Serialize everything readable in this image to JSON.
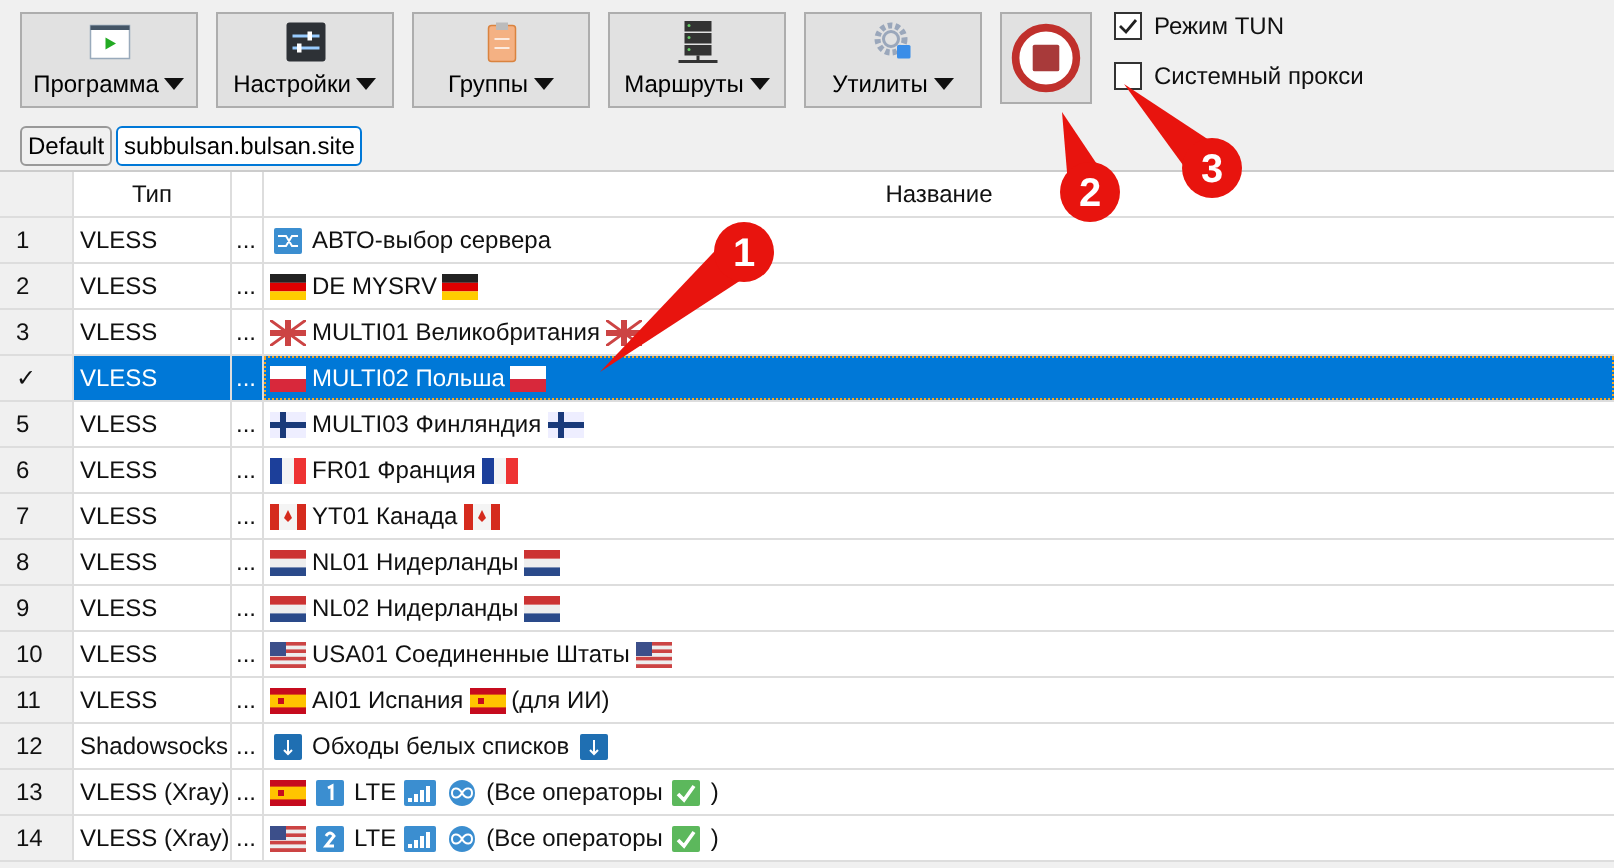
{
  "toolbar": [
    {
      "label": "Программа"
    },
    {
      "label": "Настройки"
    },
    {
      "label": "Группы"
    },
    {
      "label": "Маршруты"
    },
    {
      "label": "Утилиты"
    }
  ],
  "stop_button": {
    "kind": "stop"
  },
  "options": [
    {
      "label": "Режим TUN",
      "checked": true
    },
    {
      "label": "Системный прокси",
      "checked": false
    }
  ],
  "tabs": [
    {
      "label": "Default",
      "selected": false
    },
    {
      "label": "subbulsan.bulsan.site",
      "selected": true
    }
  ],
  "table": {
    "columns": [
      "Тип",
      "Название"
    ],
    "rows": [
      {
        "index": "1",
        "type": "VLESS",
        "dots": "...",
        "selected": false,
        "name": [
          {
            "kind": "icon"
          },
          {
            "kind": "text",
            "text": "АВТО-выбор сервера"
          }
        ]
      },
      {
        "index": "2",
        "type": "VLESS",
        "dots": "...",
        "selected": false,
        "name": [
          {
            "kind": "icon"
          },
          {
            "kind": "text",
            "text": "DE MYSRV"
          },
          {
            "kind": "icon"
          }
        ]
      },
      {
        "index": "3",
        "type": "VLESS",
        "dots": "...",
        "selected": false,
        "name": [
          {
            "kind": "icon"
          },
          {
            "kind": "text",
            "text": "MULTI01 Великобритания"
          },
          {
            "kind": "icon"
          }
        ]
      },
      {
        "index": "✓",
        "type": "VLESS",
        "dots": "...",
        "selected": true,
        "name": [
          {
            "kind": "icon"
          },
          {
            "kind": "text",
            "text": "MULTI02 Польша"
          },
          {
            "kind": "icon"
          }
        ]
      },
      {
        "index": "5",
        "type": "VLESS",
        "dots": "...",
        "selected": false,
        "name": [
          {
            "kind": "icon"
          },
          {
            "kind": "text",
            "text": "MULTI03 Финляндия"
          },
          {
            "kind": "icon"
          }
        ]
      },
      {
        "index": "6",
        "type": "VLESS",
        "dots": "...",
        "selected": false,
        "name": [
          {
            "kind": "icon"
          },
          {
            "kind": "text",
            "text": "FR01 Франция"
          },
          {
            "kind": "icon"
          }
        ]
      },
      {
        "index": "7",
        "type": "VLESS",
        "dots": "...",
        "selected": false,
        "name": [
          {
            "kind": "icon"
          },
          {
            "kind": "text",
            "text": "YT01 Канада"
          },
          {
            "kind": "icon"
          }
        ]
      },
      {
        "index": "8",
        "type": "VLESS",
        "dots": "...",
        "selected": false,
        "name": [
          {
            "kind": "icon"
          },
          {
            "kind": "text",
            "text": "NL01  Нидерланды"
          },
          {
            "kind": "icon"
          }
        ]
      },
      {
        "index": "9",
        "type": "VLESS",
        "dots": "...",
        "selected": false,
        "name": [
          {
            "kind": "icon"
          },
          {
            "kind": "text",
            "text": "NL02 Нидерланды"
          },
          {
            "kind": "icon"
          }
        ]
      },
      {
        "index": "10",
        "type": "VLESS",
        "dots": "...",
        "selected": false,
        "name": [
          {
            "kind": "icon"
          },
          {
            "kind": "text",
            "text": "USA01 Соединенные Штаты"
          },
          {
            "kind": "icon"
          }
        ]
      },
      {
        "index": "11",
        "type": "VLESS",
        "dots": "...",
        "selected": false,
        "name": [
          {
            "kind": "icon"
          },
          {
            "kind": "text",
            "text": "AI01 Испания"
          },
          {
            "kind": "icon"
          },
          {
            "kind": "text",
            "text": "(для ИИ)"
          }
        ]
      },
      {
        "index": "12",
        "type": "Shadowsocks",
        "dots": "...",
        "selected": false,
        "name": [
          {
            "kind": "icon"
          },
          {
            "kind": "text",
            "text": "Обходы белых списков"
          },
          {
            "kind": "icon"
          }
        ]
      },
      {
        "index": "13",
        "type": "VLESS (Xray)",
        "dots": "...",
        "selected": false,
        "name": [
          {
            "kind": "icon"
          },
          {
            "kind": "icon"
          },
          {
            "kind": "text",
            "text": "LTE"
          },
          {
            "kind": "icon"
          },
          {
            "kind": "icon"
          },
          {
            "kind": "text",
            "text": "(Все операторы"
          },
          {
            "kind": "icon"
          },
          {
            "kind": "text",
            "text": ")"
          }
        ]
      },
      {
        "index": "14",
        "type": "VLESS (Xray)",
        "dots": "...",
        "selected": false,
        "name": [
          {
            "kind": "icon"
          },
          {
            "kind": "icon"
          },
          {
            "kind": "text",
            "text": "LTE"
          },
          {
            "kind": "icon"
          },
          {
            "kind": "icon"
          },
          {
            "kind": "text",
            "text": "(Все операторы"
          },
          {
            "kind": "icon"
          },
          {
            "kind": "text",
            "text": ")"
          }
        ]
      }
    ]
  },
  "callouts": [
    {
      "label": "1"
    },
    {
      "label": "2"
    },
    {
      "label": "3"
    }
  ]
}
